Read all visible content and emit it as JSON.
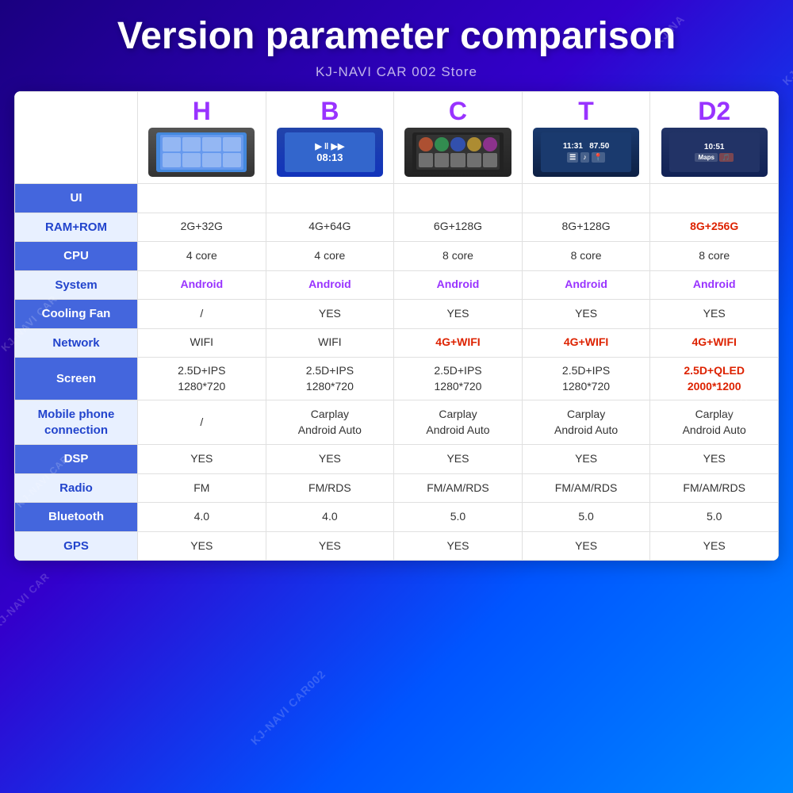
{
  "title": "Version parameter comparison",
  "store": "KJ-NAVI CAR 002 Store",
  "versions": [
    "H",
    "B",
    "C",
    "T",
    "D2"
  ],
  "rows": [
    {
      "label": "UI",
      "type": "ui",
      "values": [
        "h",
        "b",
        "c",
        "t",
        "d2"
      ]
    },
    {
      "label": "RAM+ROM",
      "values": [
        "2G+32G",
        "4G+64G",
        "6G+128G",
        "8G+128G",
        "8G+256G"
      ],
      "highlights": [
        false,
        false,
        false,
        false,
        true
      ]
    },
    {
      "label": "CPU",
      "values": [
        "4 core",
        "4 core",
        "8 core",
        "8 core",
        "8 core"
      ],
      "highlights": [
        false,
        false,
        false,
        false,
        false
      ]
    },
    {
      "label": "System",
      "values": [
        "Android",
        "Android",
        "Android",
        "Android",
        "Android"
      ],
      "type": "android"
    },
    {
      "label": "Cooling Fan",
      "values": [
        "/",
        "YES",
        "YES",
        "YES",
        "YES"
      ]
    },
    {
      "label": "Network",
      "values": [
        "WIFI",
        "WIFI",
        "4G+WIFI",
        "4G+WIFI",
        "4G+WIFI"
      ],
      "highlights": [
        false,
        false,
        true,
        true,
        true
      ]
    },
    {
      "label": "Screen",
      "values": [
        "2.5D+IPS\n1280*720",
        "2.5D+IPS\n1280*720",
        "2.5D+IPS\n1280*720",
        "2.5D+IPS\n1280*720",
        "2.5D+QLED\n2000*1200"
      ],
      "highlights": [
        false,
        false,
        false,
        false,
        true
      ]
    },
    {
      "label": "Mobile phone\nconnection",
      "values": [
        "/",
        "Carplay\nAndroid Auto",
        "Carplay\nAndroid Auto",
        "Carplay\nAndroid Auto",
        "Carplay\nAndroid Auto"
      ]
    },
    {
      "label": "DSP",
      "values": [
        "YES",
        "YES",
        "YES",
        "YES",
        "YES"
      ]
    },
    {
      "label": "Radio",
      "values": [
        "FM",
        "FM/RDS",
        "FM/AM/RDS",
        "FM/AM/RDS",
        "FM/AM/RDS"
      ]
    },
    {
      "label": "Bluetooth",
      "values": [
        "4.0",
        "4.0",
        "5.0",
        "5.0",
        "5.0"
      ]
    },
    {
      "label": "GPS",
      "values": [
        "YES",
        "YES",
        "YES",
        "YES",
        "YES"
      ]
    }
  ]
}
